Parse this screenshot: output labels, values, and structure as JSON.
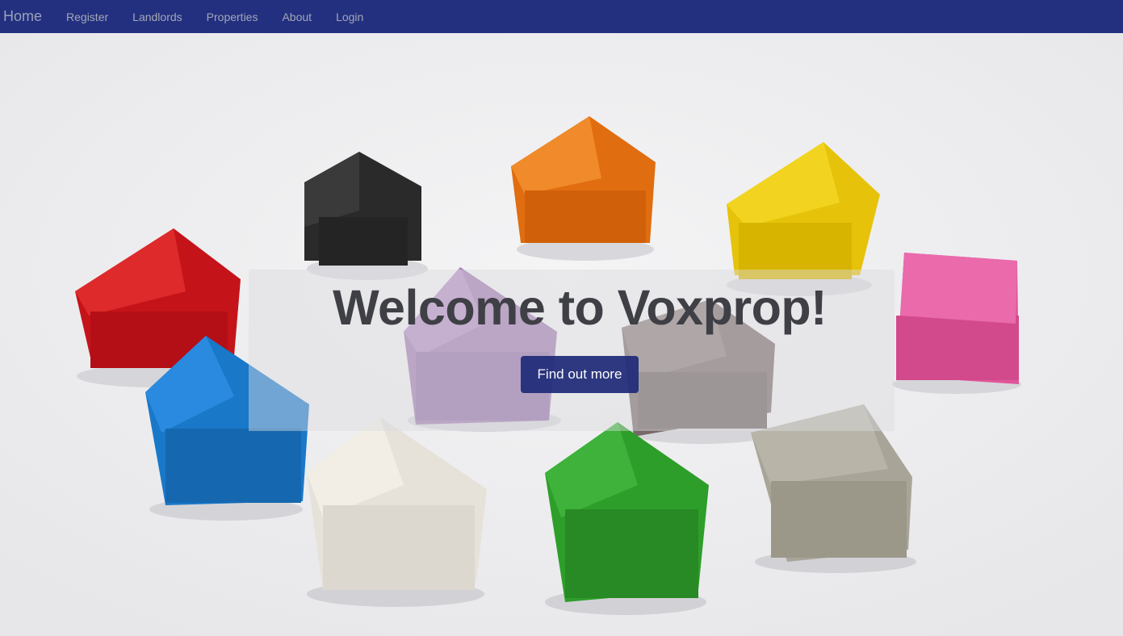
{
  "nav": {
    "brand": "Home",
    "links": [
      "Register",
      "Landlords",
      "Properties",
      "About",
      "Login"
    ],
    "background": "#233080"
  },
  "hero": {
    "title": "Welcome to Voxprop!",
    "cta_label": "Find out more",
    "cta_color": "#1f2a78",
    "image": "house-pieces-photo",
    "house_colors": [
      "#c4141a",
      "#2a2a2a",
      "#e06d10",
      "#e6c30a",
      "#e0559a",
      "#1a78c8",
      "#a07bb0",
      "#776967",
      "#e6e2da",
      "#2e9e2a",
      "#a8a598"
    ]
  }
}
